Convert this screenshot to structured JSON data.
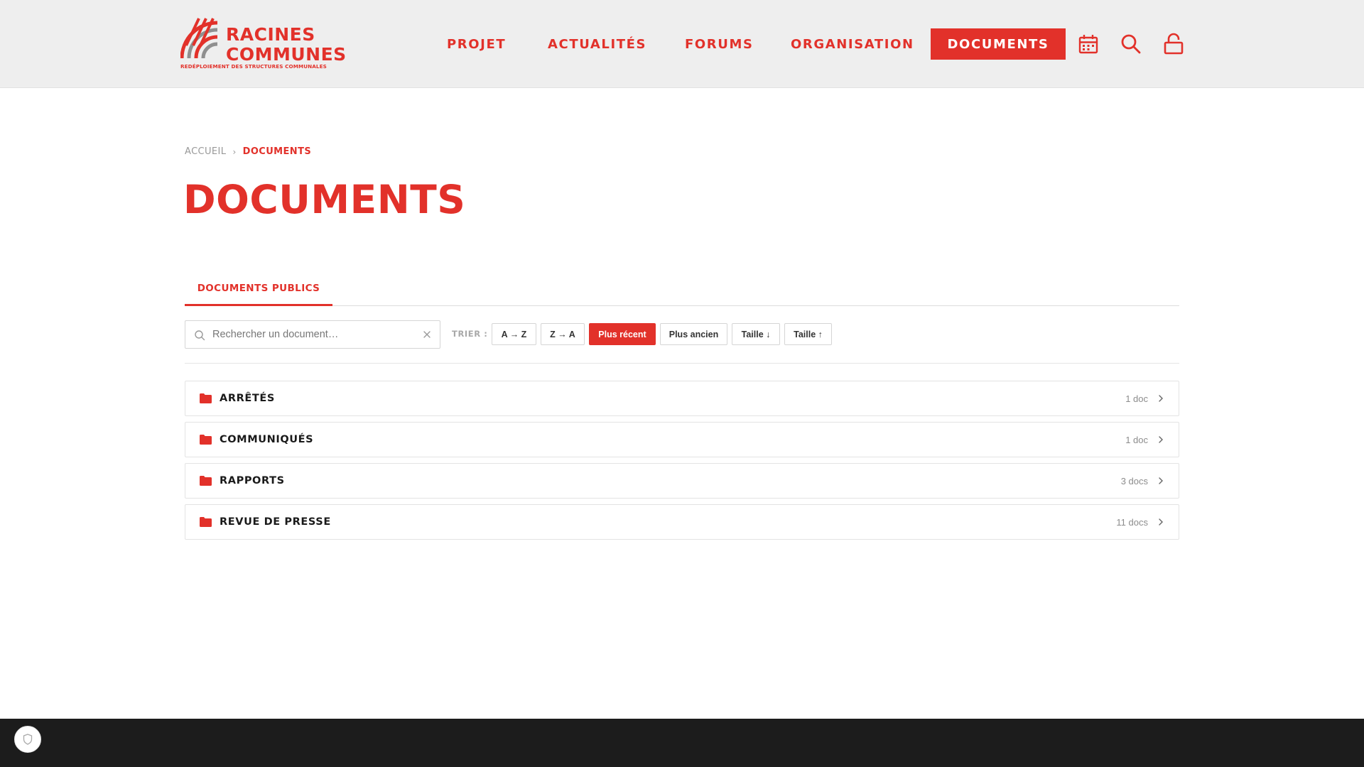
{
  "colors": {
    "brand": "#e2312a",
    "header_bg": "#eeeeee",
    "footer_bg": "#1c1c1c"
  },
  "logo": {
    "line1": "RACINES",
    "line2": "COMMUNES",
    "tagline": "REDÉPLOIEMENT DES STRUCTURES COMMUNALES"
  },
  "nav": {
    "items": [
      {
        "label": "PROJET"
      },
      {
        "label": "ACTUALITÉS"
      },
      {
        "label": "FORUMS"
      },
      {
        "label": "ORGANISATION"
      },
      {
        "label": "DOCUMENTS",
        "active": true
      }
    ],
    "icons": [
      "calendar-icon",
      "search-icon",
      "unlock-icon"
    ]
  },
  "breadcrumb": {
    "home": "ACCUEIL",
    "separator": "›",
    "current": "DOCUMENTS"
  },
  "page_title": "DOCUMENTS",
  "tabs": [
    {
      "label": "DOCUMENTS PUBLICS",
      "active": true
    }
  ],
  "search": {
    "placeholder": "Rechercher un document…",
    "value": ""
  },
  "sort": {
    "label": "TRIER :",
    "options": [
      {
        "label": "A → Z"
      },
      {
        "label": "Z → A"
      },
      {
        "label": "Plus récent",
        "active": true
      },
      {
        "label": "Plus ancien"
      },
      {
        "label": "Taille ↓"
      },
      {
        "label": "Taille ↑"
      }
    ]
  },
  "folders": [
    {
      "name": "ARRÊTÉS",
      "count": "1 doc"
    },
    {
      "name": "COMMUNIQUÉS",
      "count": "1 doc"
    },
    {
      "name": "RAPPORTS",
      "count": "3 docs"
    },
    {
      "name": "REVUE DE PRESSE",
      "count": "11 docs"
    }
  ]
}
